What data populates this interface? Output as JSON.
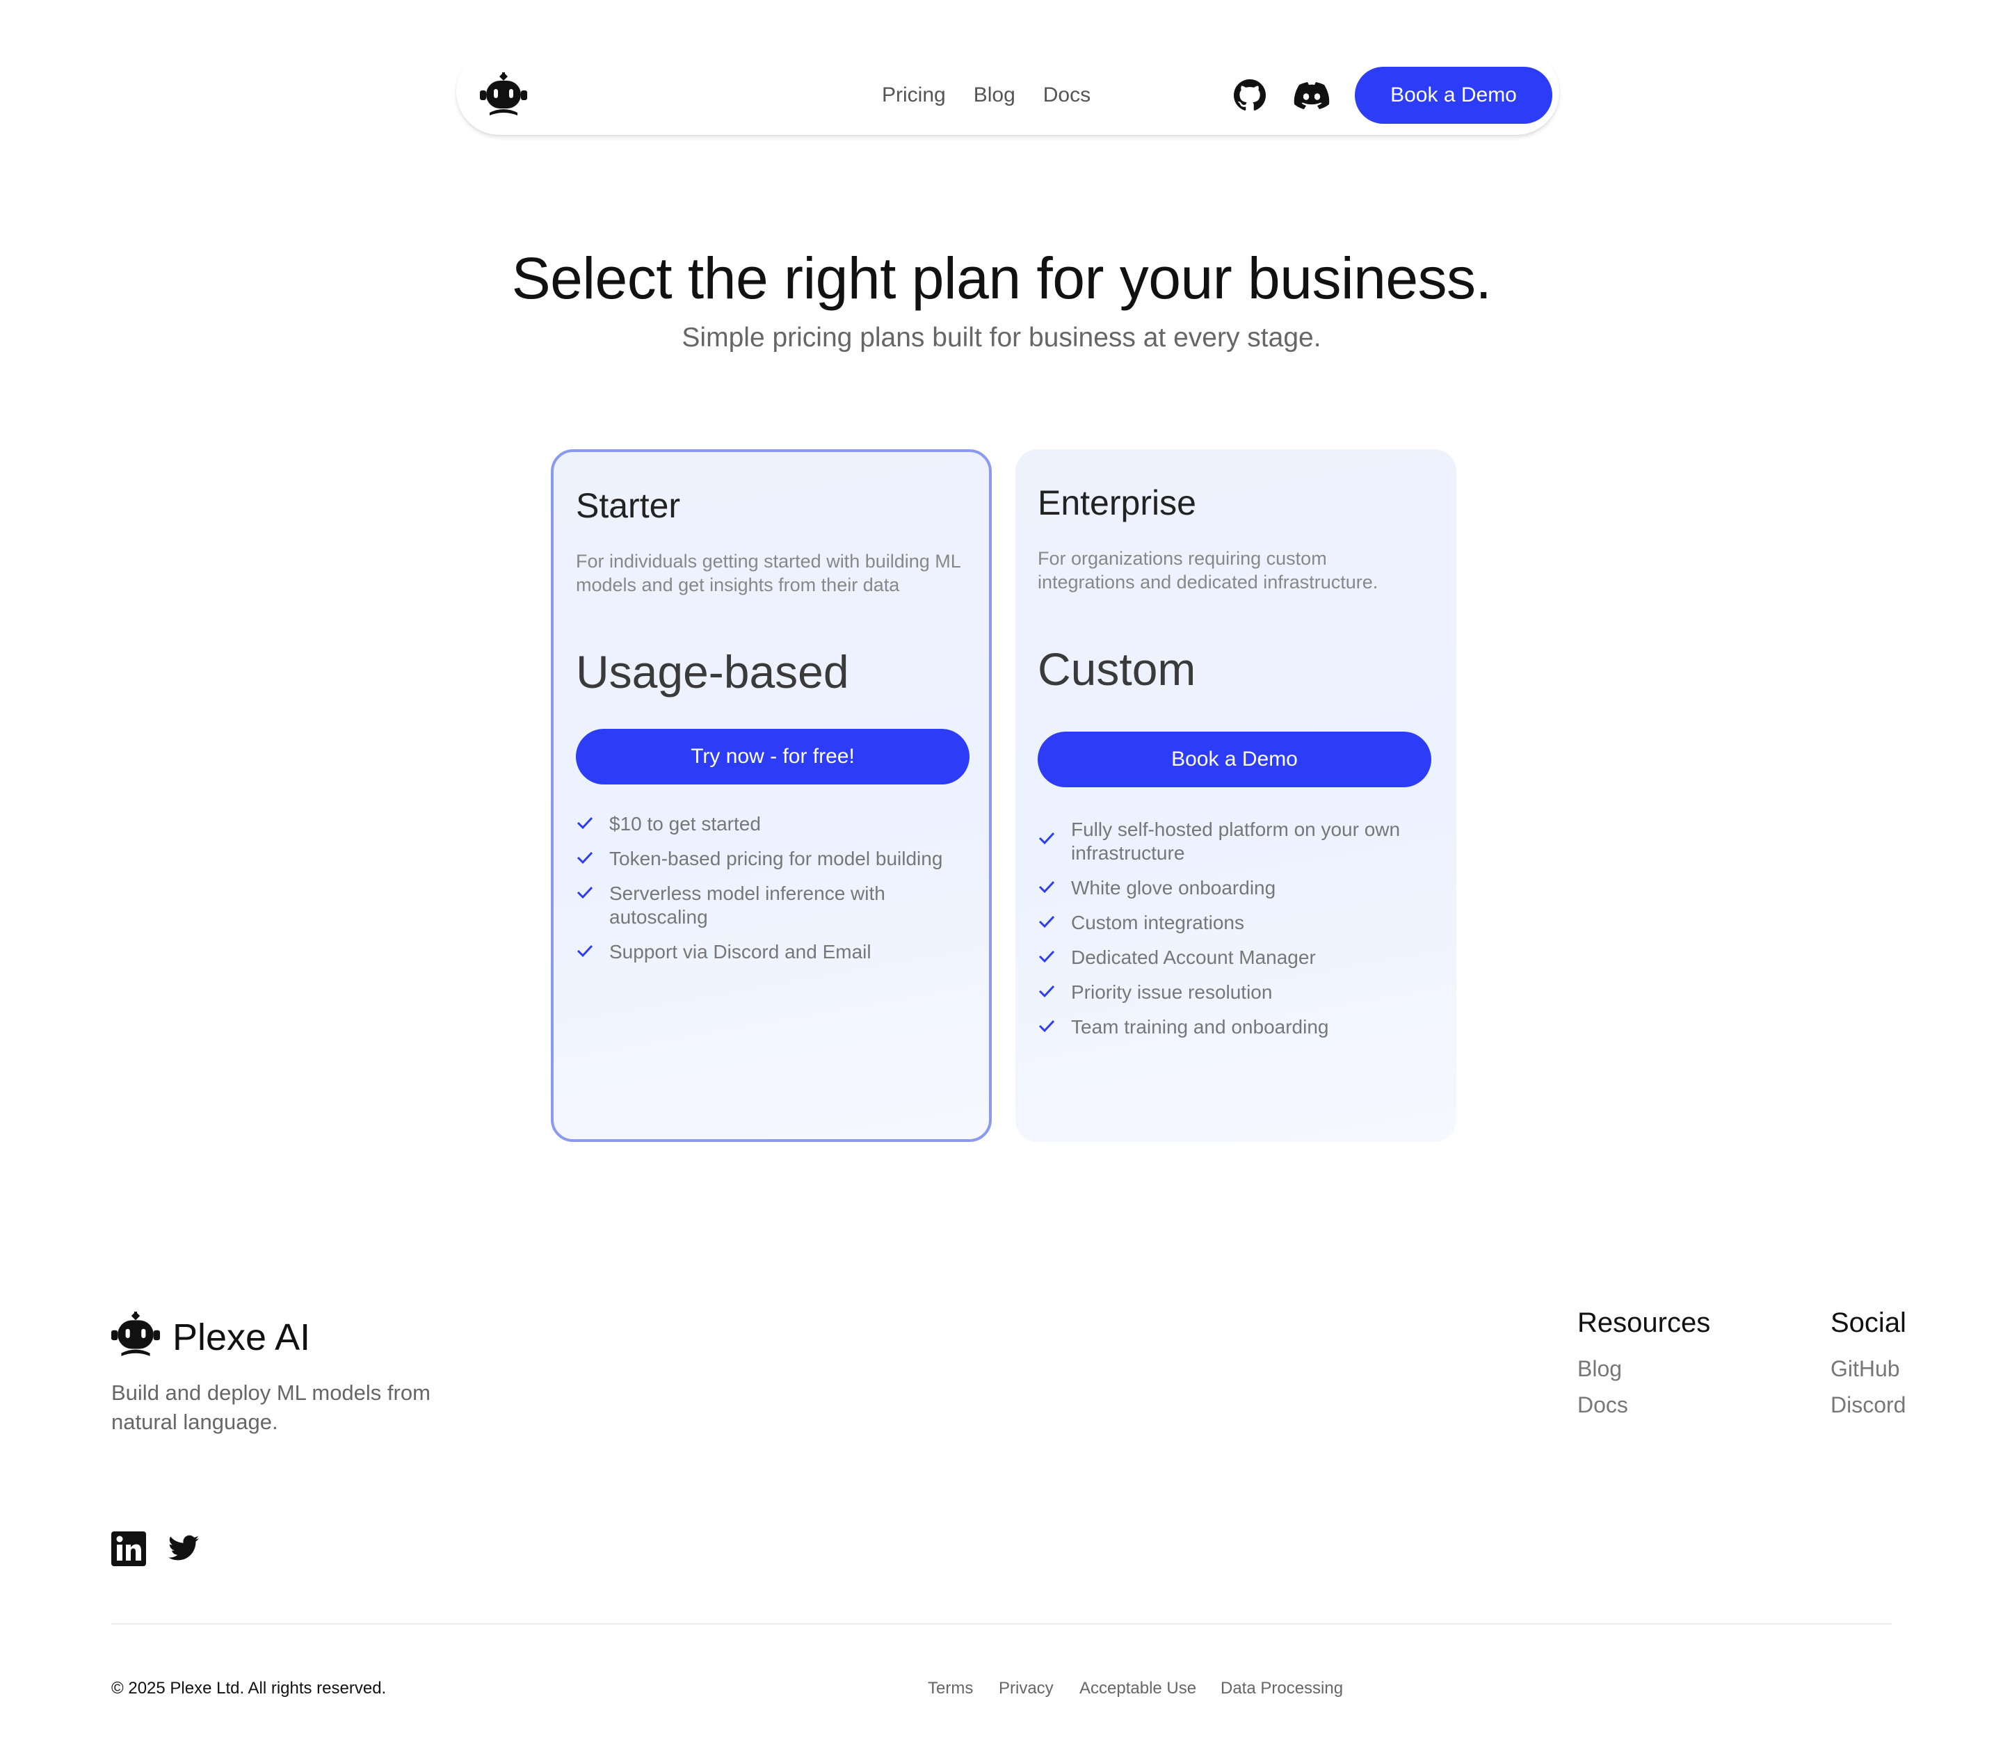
{
  "nav": {
    "links": [
      "Pricing",
      "Blog",
      "Docs"
    ],
    "cta": "Book a Demo",
    "icons": [
      "robot-logo-icon",
      "github-icon",
      "discord-icon"
    ]
  },
  "hero": {
    "title": "Select the right plan for your business.",
    "subtitle": "Simple pricing plans built for business at every stage."
  },
  "plans": [
    {
      "name": "Starter",
      "description": "For individuals getting started with building ML models and get insights from their data",
      "price": "Usage-based",
      "cta": "Try now - for free!",
      "features": [
        "$10 to get started",
        "Token-based pricing for model building",
        "Serverless model inference with autoscaling",
        "Support via Discord and Email"
      ]
    },
    {
      "name": "Enterprise",
      "description": "For organizations requiring custom integrations and dedicated infrastructure.",
      "price": "Custom",
      "cta": "Book a Demo",
      "features": [
        "Fully self-hosted platform on your own infrastructure",
        "White glove onboarding",
        "Custom integrations",
        "Dedicated Account Manager",
        "Priority issue resolution",
        "Team training and onboarding"
      ]
    }
  ],
  "footer": {
    "brand": "Plexe AI",
    "tagline": "Build and deploy ML models from natural language.",
    "resources": {
      "title": "Resources",
      "links": [
        "Blog",
        "Docs"
      ]
    },
    "social": {
      "title": "Social",
      "links": [
        "GitHub",
        "Discord"
      ]
    },
    "social_icons": [
      "linkedin-icon",
      "twitter-icon"
    ],
    "copyright": "© 2025 Plexe Ltd. All rights reserved.",
    "legal": [
      "Terms",
      "Privacy",
      "Acceptable Use",
      "Data Processing"
    ]
  },
  "colors": {
    "accent": "#2d3df7",
    "card_border": "#8b9af0",
    "check": "#2d3df7"
  }
}
